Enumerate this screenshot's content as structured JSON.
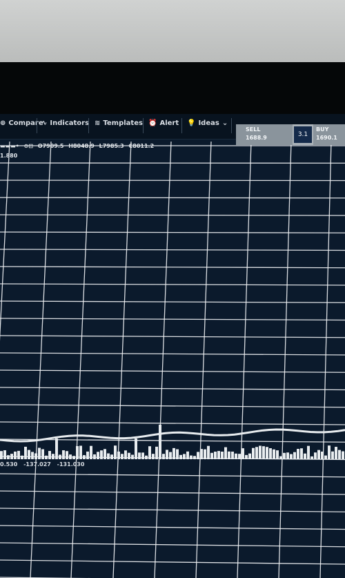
{
  "toolbar": {
    "items": [
      {
        "label": "Compare",
        "icon": "compare-icon"
      },
      {
        "label": "Indicators",
        "icon": "indicators-icon"
      },
      {
        "label": "Templates",
        "icon": "templates-icon"
      },
      {
        "label": "Alert",
        "icon": "alarm-icon"
      },
      {
        "label": "Ideas",
        "icon": "lightbulb-icon"
      }
    ]
  },
  "trade": {
    "sell_label": "SELL",
    "sell_price": "1688.9",
    "spread": "3.1",
    "buy_label": "BUY",
    "buy_price": "1690.1"
  },
  "legend": {
    "open": "O7909.5",
    "high": "H8048.9",
    "low": "L7985.3",
    "close": "C8011.2",
    "sub": "1.880"
  },
  "volume": {
    "v1": "0.530",
    "v2": "-137.027",
    "v3": "-131.030"
  },
  "colors": {
    "screen_bg": "#0b1a2c",
    "grid": "#f2f4f6",
    "series": "#e8ecef"
  }
}
